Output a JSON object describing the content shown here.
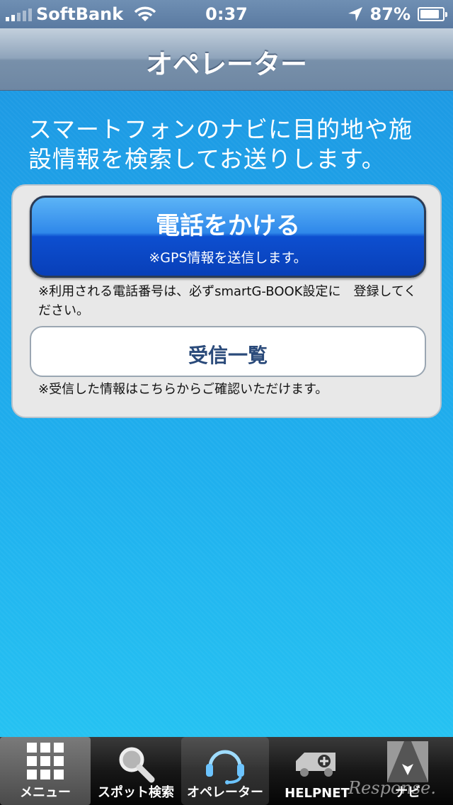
{
  "status_bar": {
    "carrier": "SoftBank",
    "time": "0:37",
    "battery": "87%",
    "battery_level": 0.87
  },
  "nav": {
    "title": "オペレーター"
  },
  "intro": "スマートフォンのナビに目的地や施設情報を検索してお送りします。",
  "call": {
    "label": "電話をかける",
    "sub": "※GPS情報を送信します。",
    "note": "※利用される電話番号は、必ずsmartG-BOOK設定に　登録してください。"
  },
  "received": {
    "label": "受信一覧",
    "note": "※受信した情報はこちらからご確認いただけます。"
  },
  "tabs": [
    {
      "label": "メニュー",
      "icon": "grid-icon"
    },
    {
      "label": "スポット検索",
      "icon": "search-icon"
    },
    {
      "label": "オペレーター",
      "icon": "headset-icon"
    },
    {
      "label": "HELPNET",
      "icon": "ambulance-icon"
    },
    {
      "label": "ナビ",
      "icon": "navi-icon"
    }
  ],
  "watermark": "Response."
}
